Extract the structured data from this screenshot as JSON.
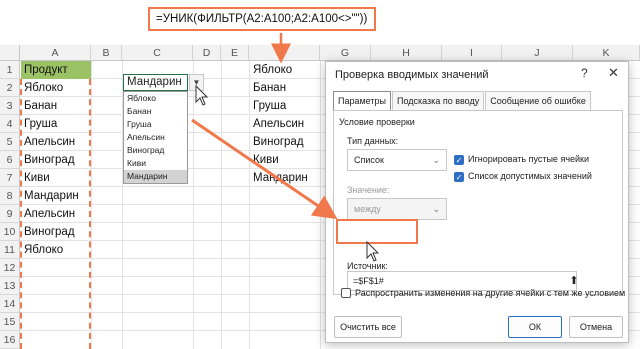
{
  "formula": "=УНИК(ФИЛЬТР(A2:A100;A2:A100<>\"\"))",
  "columns": [
    "A",
    "B",
    "C",
    "D",
    "E",
    "F",
    "G",
    "H",
    "I",
    "J",
    "K"
  ],
  "rows": [
    "1",
    "2",
    "3",
    "4",
    "5",
    "6",
    "7",
    "8",
    "9",
    "10",
    "11",
    "12",
    "13",
    "14",
    "15",
    "16"
  ],
  "column_a": [
    "Продукт",
    "Яблоко",
    "Банан",
    "Груша",
    "Апельсин",
    "Виноград",
    "Киви",
    "Мандарин",
    "Апельсин",
    "Виноград",
    "Яблоко"
  ],
  "column_f": [
    "Яблоко",
    "Банан",
    "Груша",
    "Апельсин",
    "Виноград",
    "Киви",
    "Мандарин"
  ],
  "dropdown": {
    "value": "Мандарин",
    "options": [
      "Яблоко",
      "Банан",
      "Груша",
      "Апельсин",
      "Виноград",
      "Киви",
      "Мандарин"
    ],
    "selected": "Мандарин"
  },
  "dialog": {
    "title": "Проверка вводимых значений",
    "help": "?",
    "close": "✕",
    "tabs": [
      "Параметры",
      "Подсказка по вводу",
      "Сообщение об ошибке"
    ],
    "section": "Условие проверки",
    "type_label": "Тип данных:",
    "type_value": "Список",
    "ignore_blank": "Игнорировать пустые ячейки",
    "in_cell_dropdown": "Список допустимых значений",
    "value_label": "Значение:",
    "value_value": "между",
    "source_label": "Источник:",
    "source_value": "=$F$1#",
    "propagate": "Распространить изменения на другие ячейки с тем же условием",
    "clear_all": "Очистить все",
    "ok": "ОК",
    "cancel": "Отмена"
  },
  "colors": {
    "accent": "#f0784a",
    "header_fill": "#9bc265",
    "primary": "#2f6fc3"
  }
}
